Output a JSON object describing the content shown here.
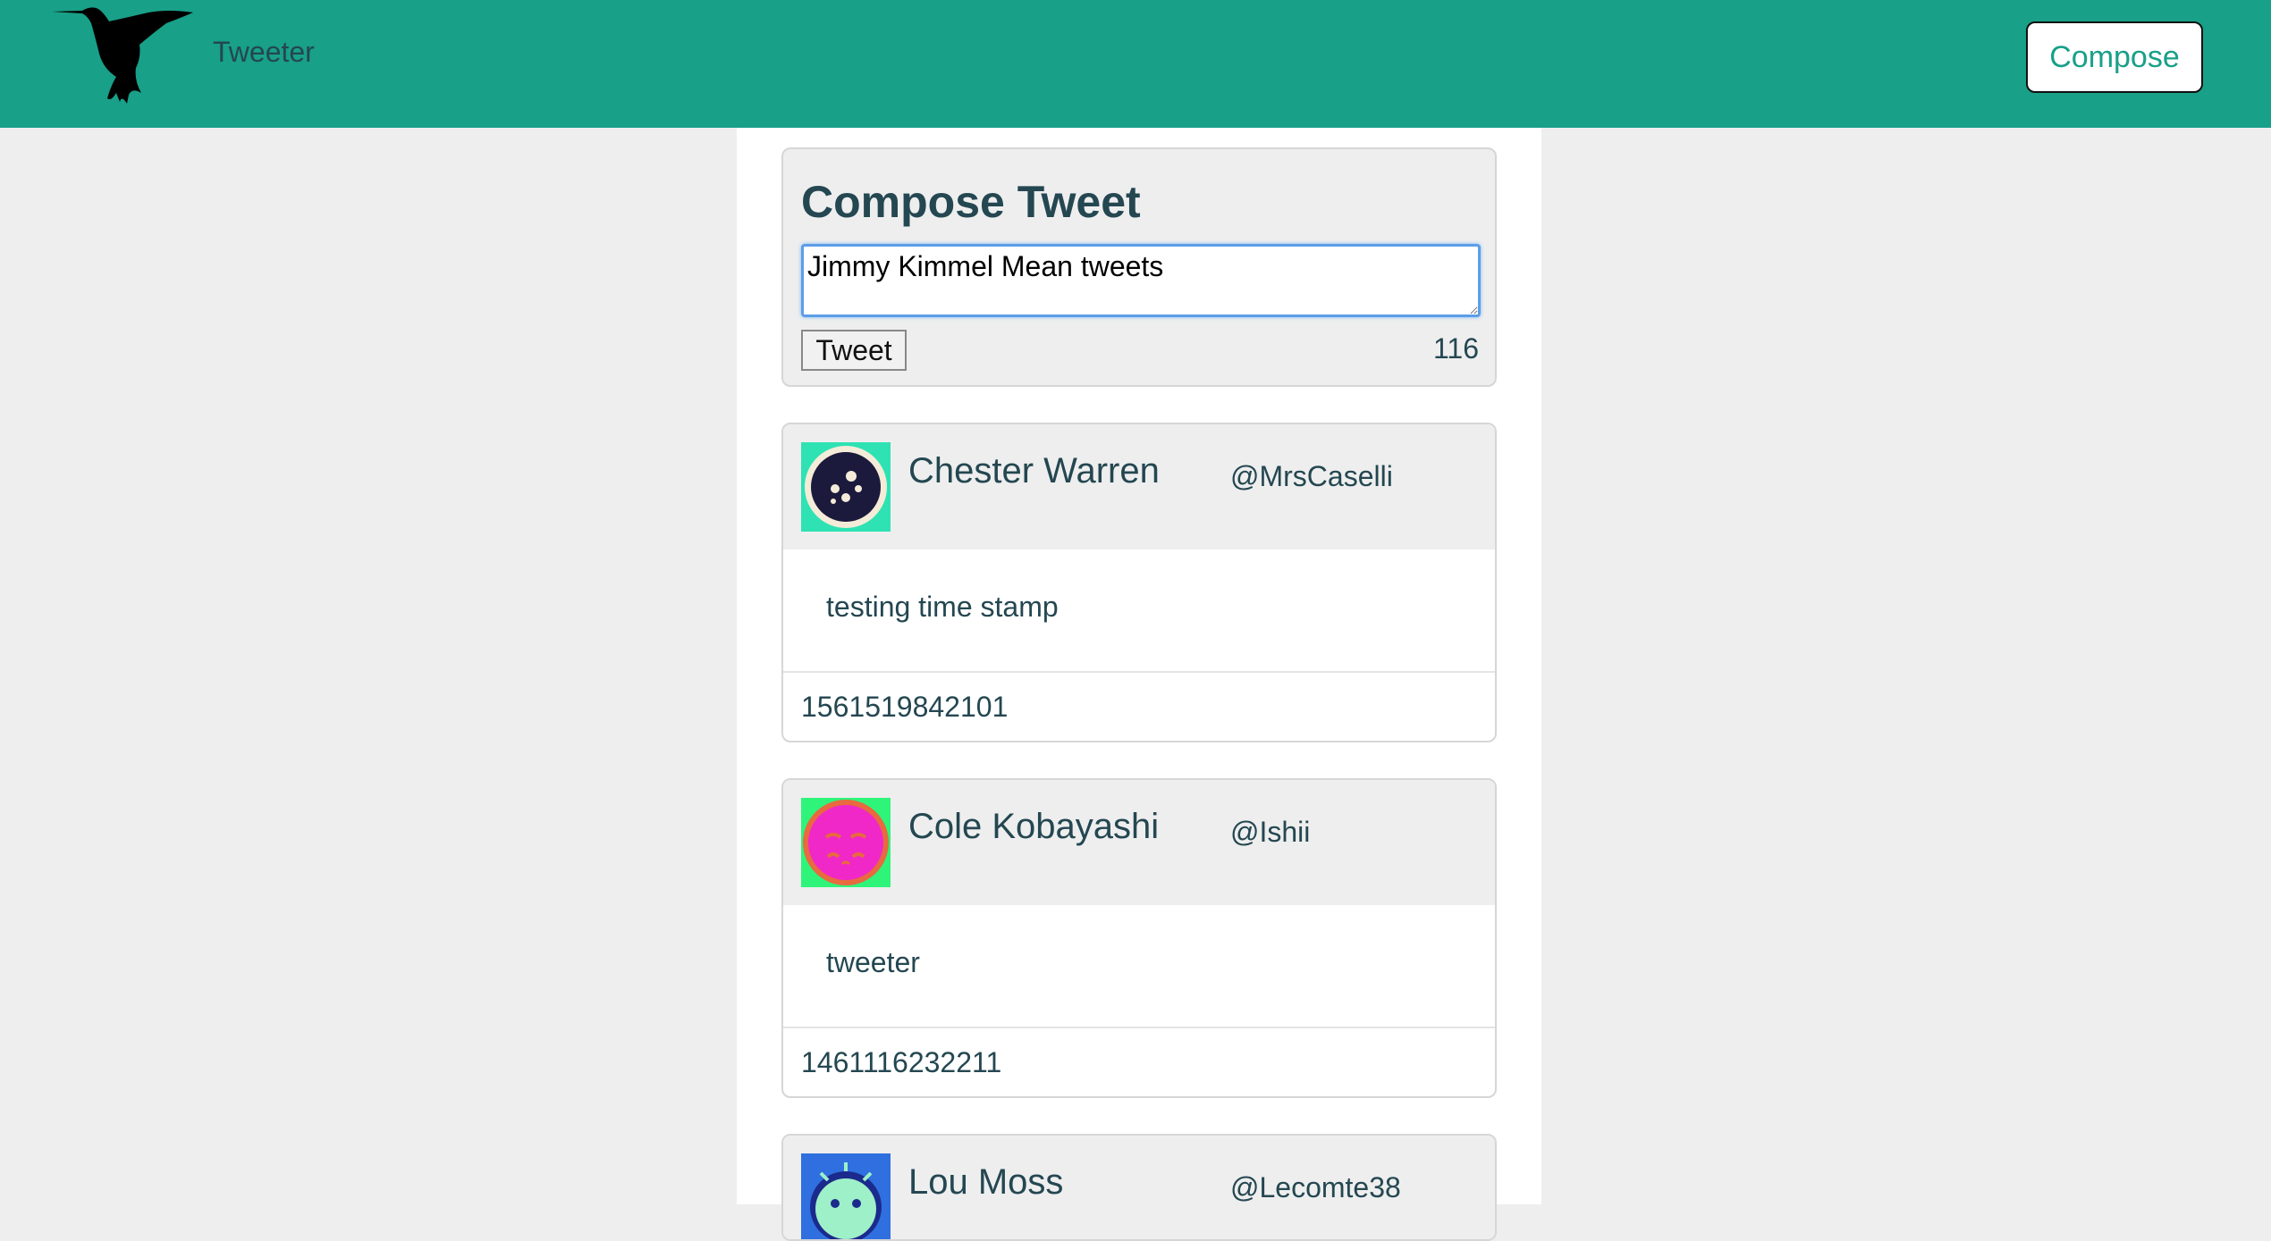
{
  "navbar": {
    "brand": "Tweeter",
    "compose_label": "Compose",
    "logo_icon": "hummingbird-icon",
    "background_color": "#18a088"
  },
  "compose": {
    "title": "Compose Tweet",
    "input_value": "Jimmy Kimmel Mean tweets",
    "tweet_label": "Tweet",
    "counter": "116"
  },
  "tweets": [
    {
      "name": "Chester Warren",
      "handle": "@MrsCaselli",
      "text": "testing time stamp",
      "timestamp": "1561519842101",
      "avatar_icon": "avatar-dark-circle-icon"
    },
    {
      "name": "Cole Kobayashi",
      "handle": "@Ishii",
      "text": "tweeter",
      "timestamp": "1461116232211",
      "avatar_icon": "avatar-sleepy-face-icon"
    },
    {
      "name": "Lou Moss",
      "handle": "@Lecomte38",
      "avatar_icon": "avatar-blue-face-icon"
    }
  ]
}
